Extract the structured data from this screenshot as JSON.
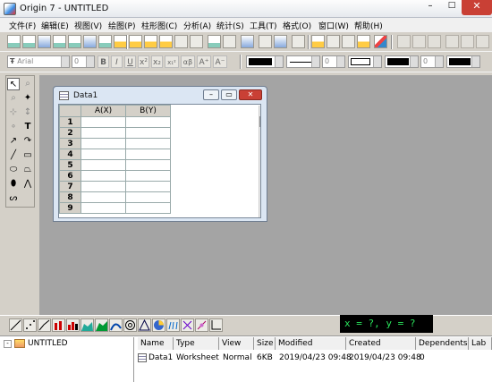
{
  "window": {
    "title": "Origin 7 - UNTITLED"
  },
  "menu": [
    "文件(F)",
    "编辑(E)",
    "视图(V)",
    "绘图(P)",
    "柱形图(C)",
    "分析(A)",
    "统计(S)",
    "工具(T)",
    "格式(O)",
    "窗口(W)",
    "帮助(H)"
  ],
  "format": {
    "font": "Arial",
    "size": "0",
    "bold": "B",
    "italic": "I",
    "underline": "U",
    "sup": "x²",
    "sub": "x₂",
    "supsub": "x₁²",
    "greek": "αβ",
    "bigger": "A⁺",
    "smaller": "A⁻",
    "num1": "0",
    "num2": "0"
  },
  "worksheet": {
    "title": "Data1",
    "columns": [
      "A(X)",
      "B(Y)"
    ],
    "rows": [
      "1",
      "2",
      "3",
      "4",
      "5",
      "6",
      "7",
      "8",
      "9"
    ]
  },
  "status": {
    "coords": "x = ?, y = ?"
  },
  "project": {
    "root": "UNTITLED",
    "headers": [
      "Name",
      "Type",
      "View",
      "Size",
      "Modified",
      "Created",
      "Dependents",
      "Lab"
    ],
    "items": [
      {
        "name": "Data1",
        "type": "Worksheet",
        "view": "Normal",
        "size": "6KB",
        "modified": "2019/04/23 09:48",
        "created": "2019/04/23 09:48",
        "dependents": "0"
      }
    ]
  }
}
